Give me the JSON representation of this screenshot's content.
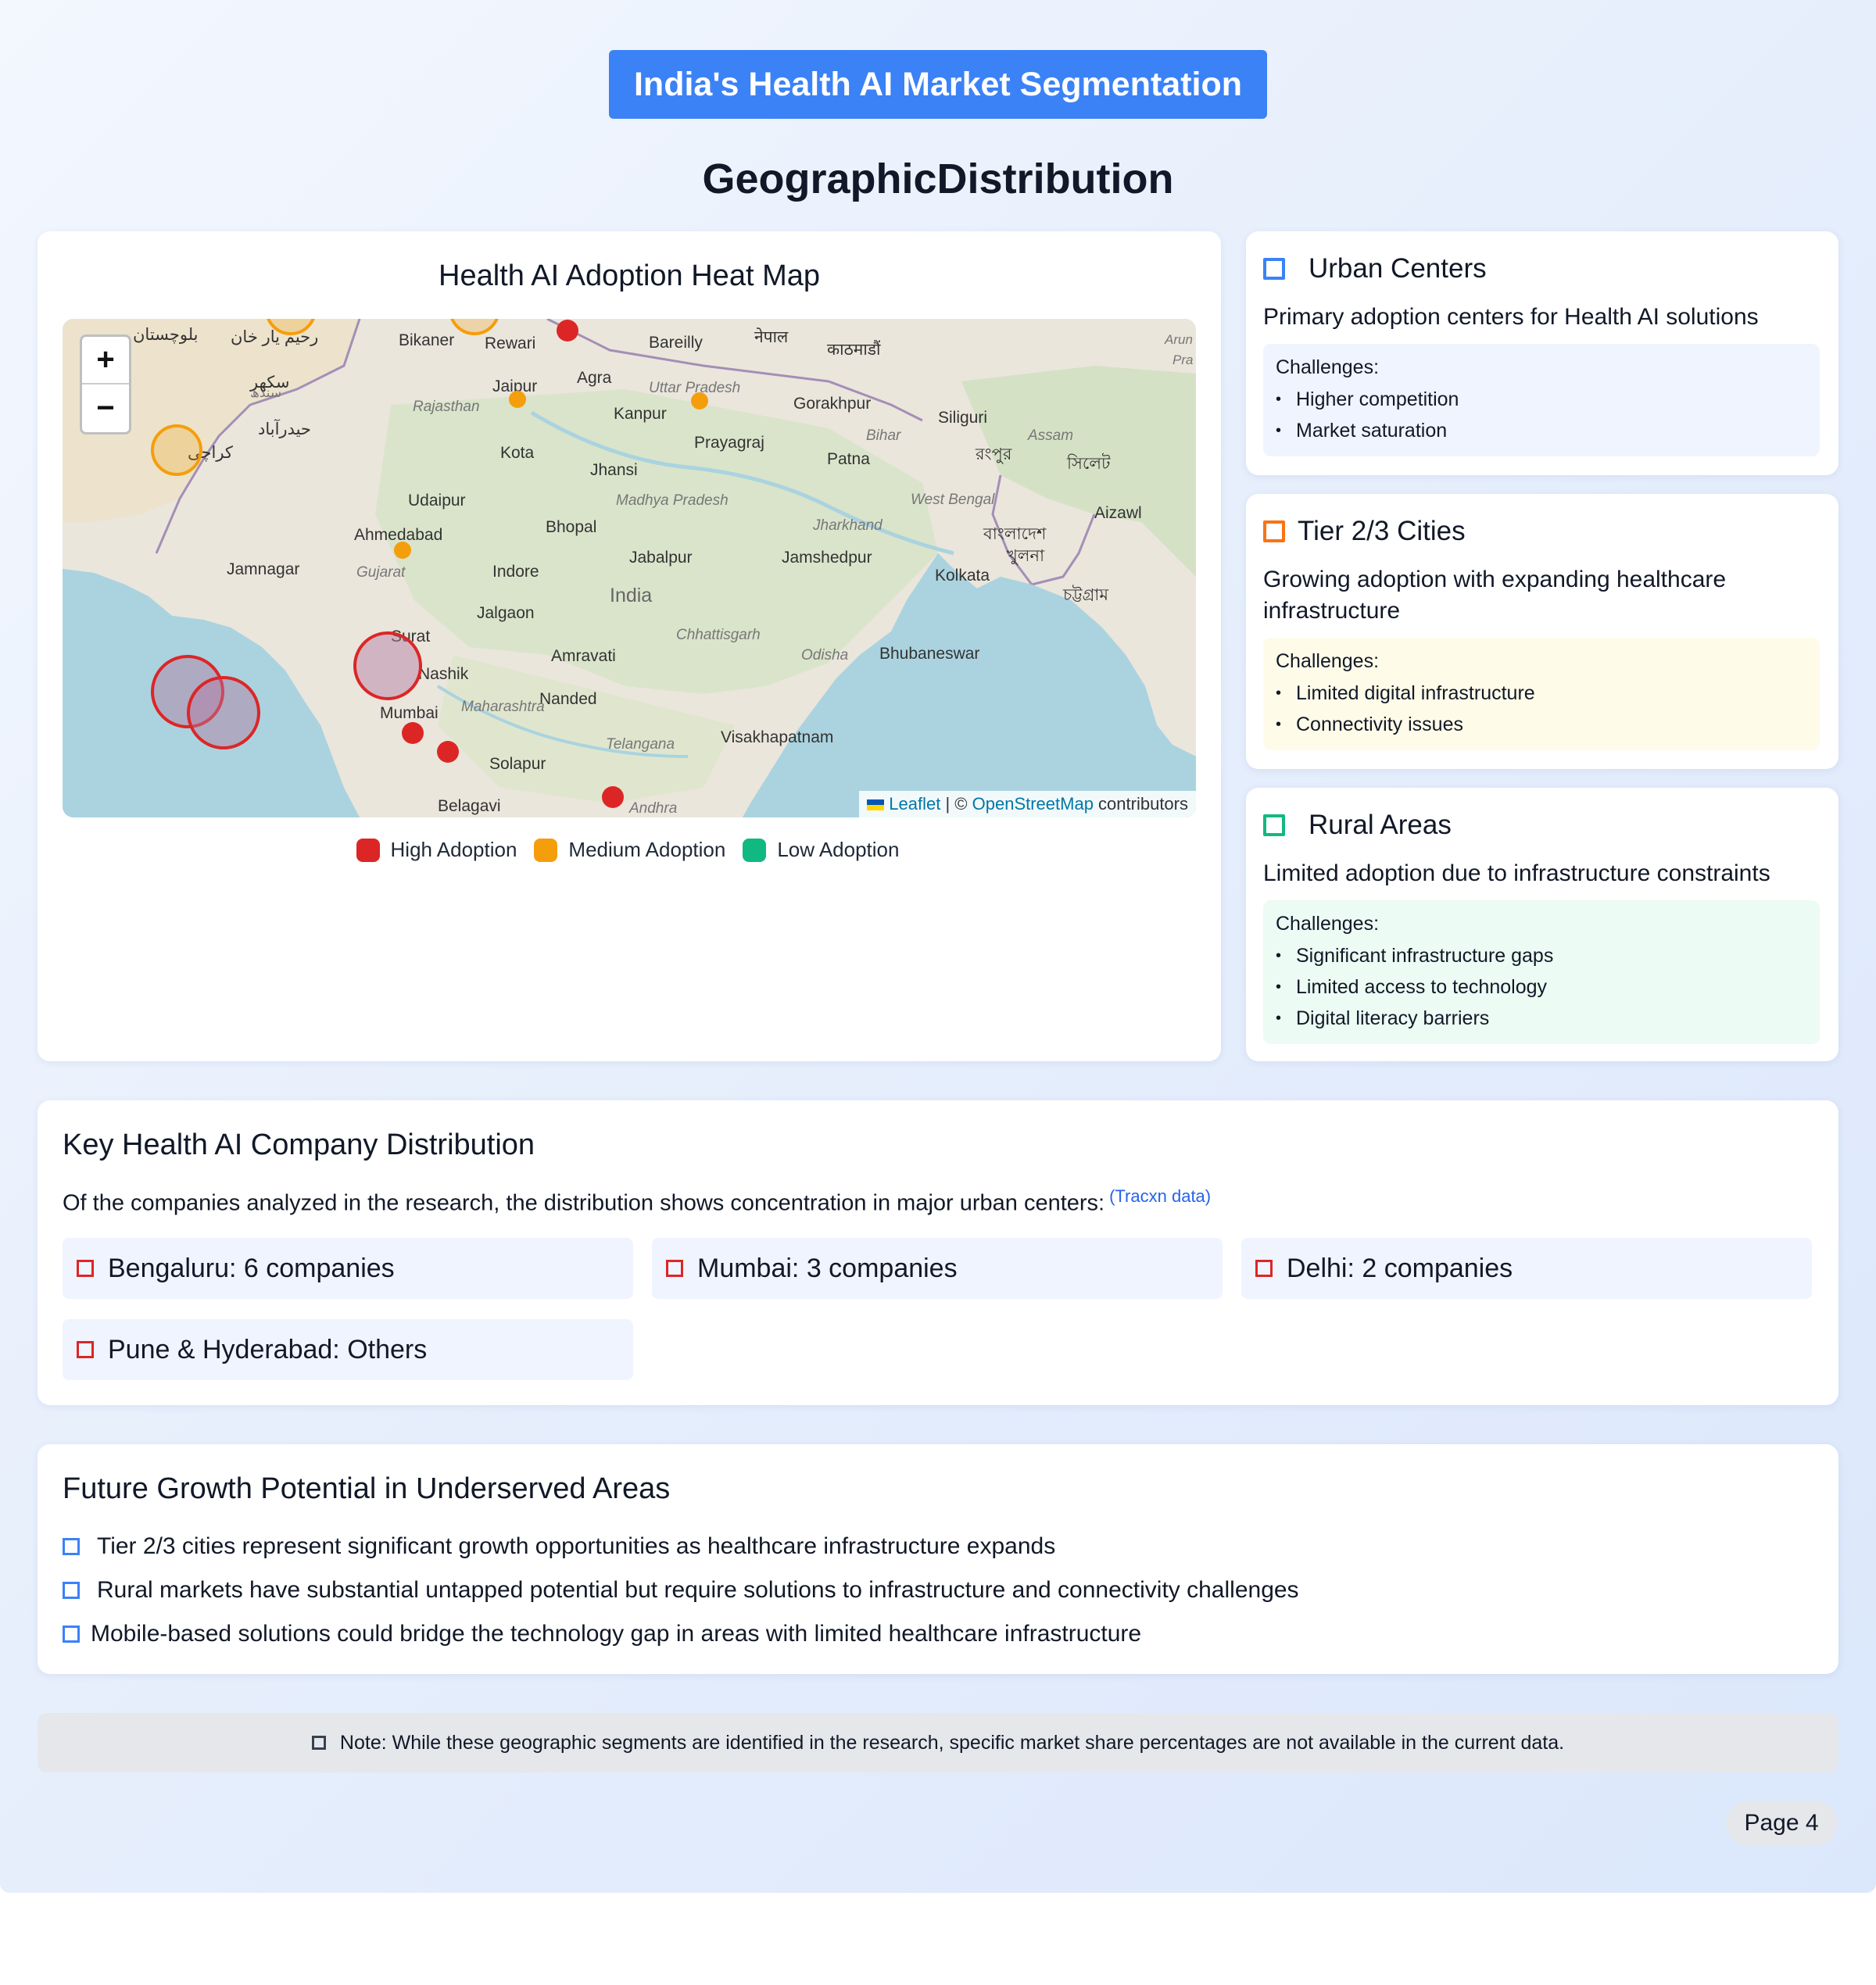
{
  "header": {
    "badge": "India's Health AI Market Segmentation",
    "subtitle": "GeographicDistribution"
  },
  "map": {
    "title": "Health AI Adoption Heat Map",
    "zoom_in": "+",
    "zoom_out": "−",
    "attribution": {
      "leaflet": "Leaflet",
      "sep": " | © ",
      "osm": "OpenStreetMap",
      "suffix": " contributors"
    },
    "place_labels": [
      "بلوچستان",
      "رحیم یار خان",
      "سکھر",
      "سندھ",
      "حیدرآباد",
      "کراچی",
      "Bikaner",
      "Rewari",
      "Jaipur",
      "Agra",
      "Bareilly",
      "नेपाल",
      "काठमाडौं",
      "Uttar Pradesh",
      "Gorakhpur",
      "Kanpur",
      "Rajasthan",
      "Kota",
      "Prayagraj",
      "Bihar",
      "Siliguri",
      "Patna",
      "Jhansi",
      "Udaipur",
      "Madhya Pradesh",
      "Bhopal",
      "Ahmedabad",
      "Indore",
      "Jabalpur",
      "Jharkhand",
      "Jamshedpur",
      "West Bengal",
      "Kolkata",
      "Gujarat",
      "Jamnagar",
      "India",
      "Jalgaon",
      "Amravati",
      "Chhattisgarh",
      "Odisha",
      "Bhubaneswar",
      "Surat",
      "Nashik",
      "Nanded",
      "Mumbai",
      "Maharashtra",
      "Telangana",
      "Visakhapatnam",
      "Solapur",
      "Belagavi",
      "Andhra",
      "Aizawl",
      "Assam",
      "বাংলাদেশ",
      "খুলনা",
      "চট্টগ্রাম",
      "সিলেট",
      "রংপুর",
      "Arun",
      "Pra"
    ],
    "legend": [
      {
        "label": "High Adoption",
        "color": "#dc2626"
      },
      {
        "label": "Medium Adoption",
        "color": "#f59e0b"
      },
      {
        "label": "Low Adoption",
        "color": "#10b981"
      }
    ]
  },
  "segments": [
    {
      "title": "Urban Centers",
      "icon": "square-icon",
      "color": "#3b82f6",
      "box_bg": "#eff4fe",
      "description": "Primary adoption centers for Health AI solutions",
      "challenges_label": "Challenges:",
      "challenges": [
        "Higher competition",
        "Market saturation"
      ]
    },
    {
      "title": "Tier 2/3 Cities",
      "icon": "square-icon",
      "color": "#f59e0b",
      "box_bg": "#fefbe9",
      "description": "Growing adoption with expanding healthcare infrastructure",
      "challenges_label": "Challenges:",
      "challenges": [
        "Limited digital infrastructure",
        "Connectivity issues"
      ]
    },
    {
      "title": "Rural Areas",
      "icon": "square-icon",
      "color": "#10b981",
      "box_bg": "#ecfbf3",
      "description": "Limited adoption due to infrastructure constraints",
      "challenges_label": "Challenges:",
      "challenges": [
        "Significant infrastructure gaps",
        "Limited access to technology",
        "Digital literacy barriers"
      ]
    }
  ],
  "companies": {
    "title": "Key Health AI Company Distribution",
    "intro": "Of the companies analyzed in the research, the distribution shows concentration in major urban centers:",
    "source": "(Tracxn data)",
    "items": [
      "Bengaluru: 6 companies",
      "Mumbai: 3 companies",
      "Delhi: 2 companies",
      "Pune & Hyderabad: Others"
    ]
  },
  "growth": {
    "title": "Future Growth Potential in Underserved Areas",
    "items": [
      "Tier 2/3 cities represent significant growth opportunities as healthcare infrastructure expands",
      "Rural markets have substantial untapped potential but require solutions to infrastructure and connectivity challenges",
      "Mobile-based solutions could bridge the technology gap in areas with limited healthcare infrastructure"
    ]
  },
  "note": "Note: While these geographic segments are identified in the research, specific market share percentages are not available in the current data.",
  "page": "Page 4"
}
